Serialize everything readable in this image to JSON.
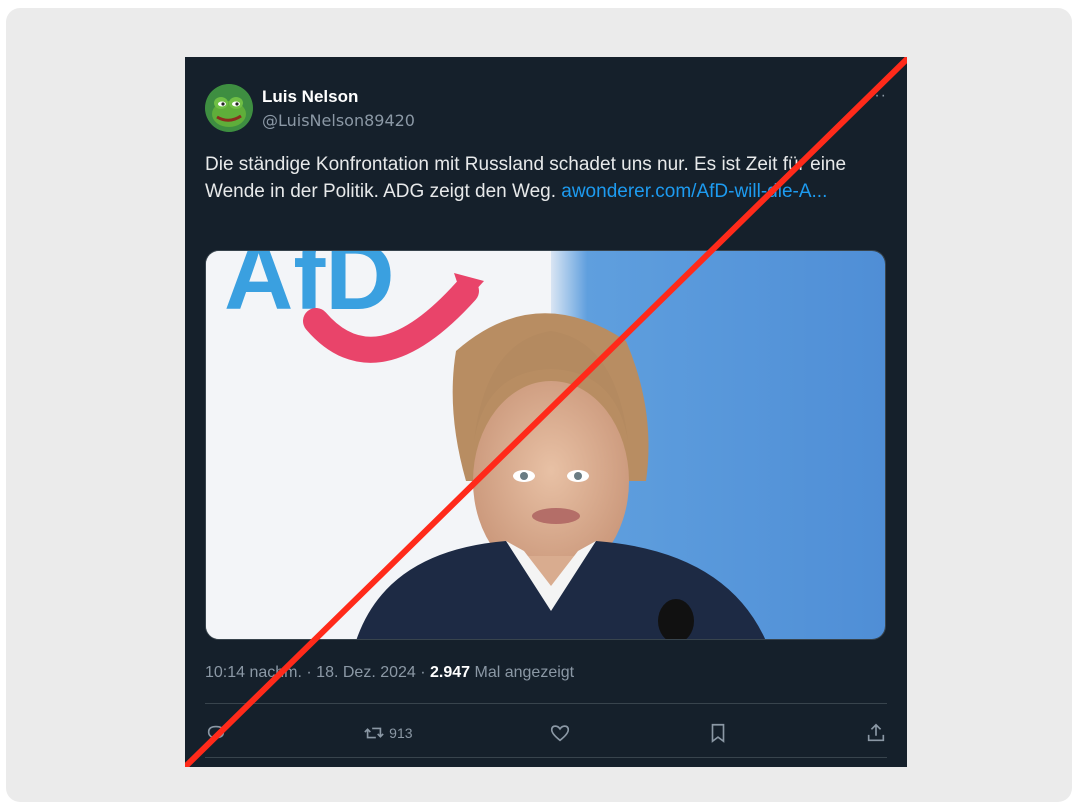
{
  "author": {
    "display_name": "Luis Nelson",
    "handle": "@LuisNelson89420",
    "avatar_icon": "frog-avatar-icon"
  },
  "more_icon": "···",
  "tweet": {
    "text": "Die ständige Konfrontation mit Russland schadet uns nur. Es ist Zeit für eine Wende in der Politik. ADG zeigt den Weg. ",
    "link_text": "awonderer.com/AfD-will-die-A..."
  },
  "media": {
    "logo_text": "AfD",
    "description_icon": "photo-woman-speaking-icon"
  },
  "meta": {
    "time_date": "10:14 nachm. · 18. Dez. 2024 · ",
    "views_count": "2.947",
    "views_label": " Mal angezeigt"
  },
  "actions": {
    "reply_icon": "reply-icon",
    "retweet_icon": "retweet-icon",
    "retweet_count": "913",
    "like_icon": "heart-icon",
    "bookmark_icon": "bookmark-icon",
    "share_icon": "share-icon"
  },
  "colors": {
    "background": "#15202b",
    "link": "#1d9bf0",
    "strike": "#ff2a1a",
    "frame": "#ebebeb"
  }
}
